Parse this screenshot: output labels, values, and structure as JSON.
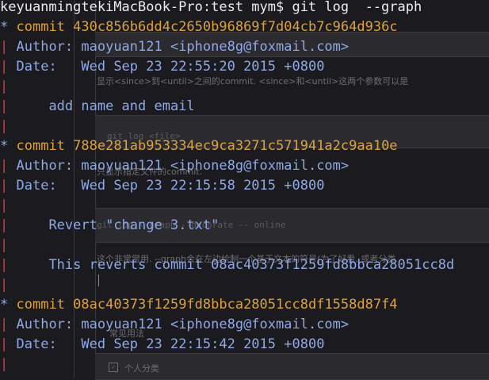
{
  "terminal": {
    "prompt": "keyuanmingtekiMacBook-Pro:test mym$ git log  --graph",
    "commits": [
      {
        "hash_line": "commit 430c856b6dd4c2650b96869f7d04cb7c964d936c",
        "author": "Author: maoyuan121 <iphone8g@foxmail.com>",
        "date": "Date:   Wed Sep 23 22:55:20 2015 +0800",
        "message": [
          "add name and email"
        ]
      },
      {
        "hash_line": "commit 788e281ab953334ec9ca3271c571941a2c9aa10e",
        "author": "Author: maoyuan121 <iphone8g@foxmail.com>",
        "date": "Date:   Wed Sep 23 22:15:58 2015 +0800",
        "message": [
          "Revert \"change 3.txt\"",
          "This reverts commit 08ac40373f1259fd8bbca28051cc8d"
        ]
      },
      {
        "hash_line": "commit 08ac40373f1259fd8bbca28051cc8df1558d87f4",
        "author": "Author: maoyuan121 <iphone8g@foxmail.com>",
        "date": "Date:   Wed Sep 23 22:15:42 2015 +0800"
      }
    ],
    "graph_star": "*",
    "graph_bar": "|"
  },
  "background_doc": {
    "line1": "显示<since>到<until>之间的commit. <since>和<until>这两个参数可以是",
    "code1": "git log <file>",
    "line2": "只显示指定文件的commit.",
    "code2": "git log --graph --decorate -- online",
    "line3": "这个非常常用. --graph会在左边绘制一个基于文本的符号(为了好看, 或者分类",
    "line4": "常见用法",
    "checkbox_mark": "✓",
    "line5": "个人分类"
  },
  "colors": {
    "prompt": "#ececec",
    "commit_hash": "#dca23a",
    "text": "#8fa8e6",
    "graph_bar": "#d83c3c"
  }
}
